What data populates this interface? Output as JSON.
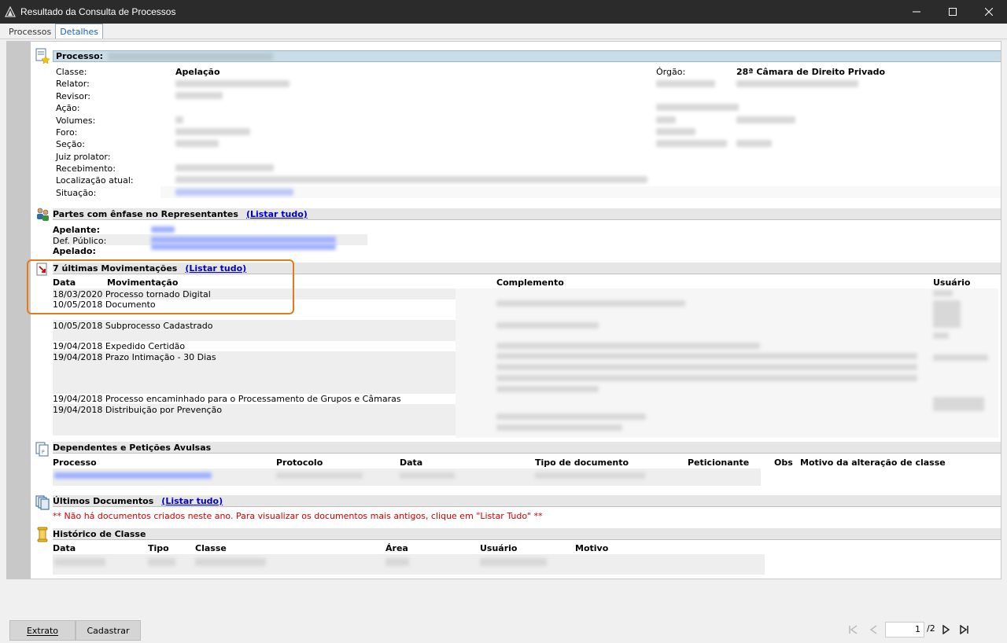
{
  "window": {
    "title": "Resultado da Consulta de Processos"
  },
  "tabs": [
    {
      "label": "Processos"
    },
    {
      "label": "Detalhes"
    }
  ],
  "processo": {
    "header": "Processo:",
    "labels": [
      "Classe:",
      "Relator:",
      "Revisor:",
      "Ação:",
      "Volumes:",
      "Foro:",
      "Seção:",
      "Juiz prolator:",
      "Recebimento:",
      "Localização atual:",
      "Situação:"
    ],
    "classe": "Apelação",
    "orgao_label": "Órgão:",
    "orgao": "28ª Câmara de Direito Privado"
  },
  "partes": {
    "header": "Partes com ênfase no Representantes",
    "link": "(Listar tudo)",
    "labels": [
      "Apelante:",
      "Def. Público:",
      "Apelado:"
    ]
  },
  "movimentacoes": {
    "header": "7 últimas Movimentações",
    "link": "(Listar tudo)",
    "columns": [
      "Data",
      "Movimentação",
      "Complemento",
      "Usuário"
    ],
    "rows": [
      "18/03/2020 Processo tornado Digital",
      "10/05/2018 Documento",
      "10/05/2018 Subprocesso Cadastrado",
      "19/04/2018 Expedido Certidão",
      "19/04/2018 Prazo Intimação - 30 Dias",
      "19/04/2018 Processo encaminhado para o Processamento de Grupos e Câmaras",
      "19/04/2018 Distribuição por Prevenção"
    ]
  },
  "dependentes": {
    "header": "Dependentes e Petições Avulsas",
    "columns": [
      "Processo",
      "Protocolo",
      "Data",
      "Tipo de documento",
      "Peticionante",
      "Obs",
      "Motivo da alteração de classe"
    ]
  },
  "documentos": {
    "header": "Últimos Documentos",
    "link": "(Listar tudo)",
    "message": "** Não há documentos criados neste ano. Para visualizar os documentos mais antigos, clique em \"Listar Tudo\" **"
  },
  "historico": {
    "header": "Histórico de Classe",
    "columns": [
      "Data",
      "Tipo",
      "Classe",
      "Área",
      "Usuário",
      "Motivo"
    ]
  },
  "footer": {
    "buttons": [
      "Extrato",
      "Cadastrar"
    ],
    "page_current": "1",
    "page_total": "/2"
  }
}
